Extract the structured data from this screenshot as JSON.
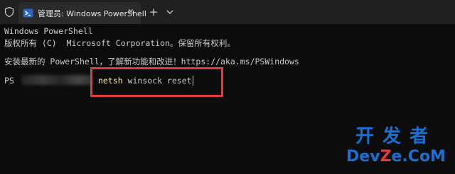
{
  "window": {
    "tab_title": "管理员: Windows PowerShell",
    "tab_close": "✕",
    "new_tab": "+",
    "accent": "#2b2b2b"
  },
  "terminal": {
    "lines": [
      "Windows PowerShell",
      "版权所有 (C)  Microsoft Corporation。保留所有权利。",
      "",
      "安装最新的 PowerShell，了解新功能和改进！https://aka.ms/PSWindows"
    ],
    "prompt_prefix": "PS",
    "command_keyword": "netsh",
    "command_args": " winsock reset",
    "highlight_color": "#e23b3b"
  },
  "watermark": {
    "top": "开发者",
    "bottom_a": "Dev",
    "bottom_b": "Z",
    "bottom_c": "e.CoM"
  }
}
